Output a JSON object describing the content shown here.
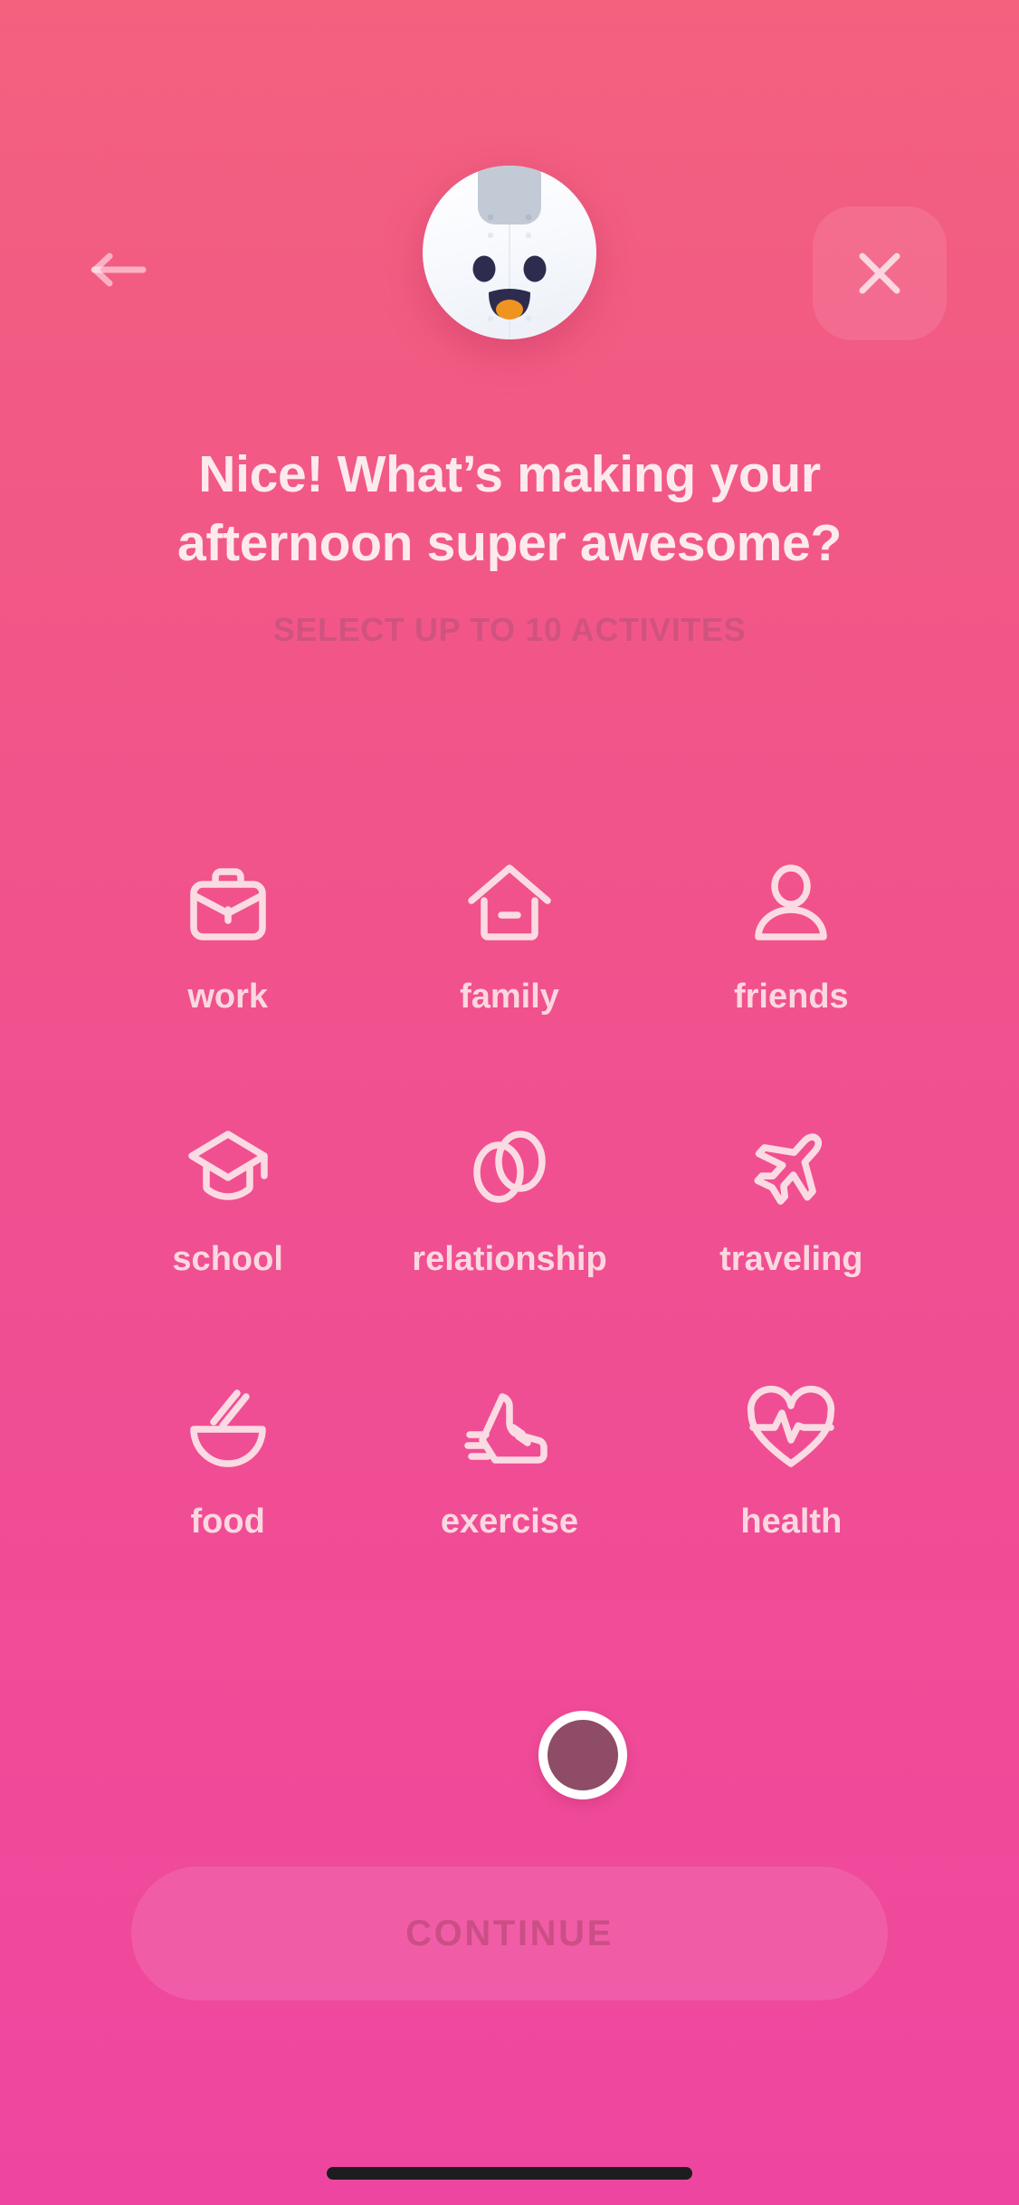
{
  "screen": {
    "name": "activity-select",
    "background_top": "#f3617f",
    "background_bottom": "#ee46a0"
  },
  "header": {
    "back_icon": "arrow-left-icon",
    "close_icon": "close-x-icon",
    "mascot_icon": "mascot-avatar-icon",
    "mascot_description": "white round character face with gray cap, dark eyes and open mouth with orange tongue"
  },
  "headings": {
    "title": "Nice! What’s making your afternoon super awesome?",
    "subtitle": "SELECT UP TO 10 ACTIVITES",
    "title_color": "#fdeaee",
    "subtitle_color": "#d0537f"
  },
  "activities": [
    {
      "label": "work",
      "icon": "briefcase-icon",
      "selected": false
    },
    {
      "label": "family",
      "icon": "house-icon",
      "selected": false
    },
    {
      "label": "friends",
      "icon": "person-icon",
      "selected": false
    },
    {
      "label": "school",
      "icon": "graduation-cap-icon",
      "selected": false
    },
    {
      "label": "relationship",
      "icon": "linked-rings-icon",
      "selected": false
    },
    {
      "label": "traveling",
      "icon": "airplane-icon",
      "selected": false
    },
    {
      "label": "food",
      "icon": "bowl-chopsticks-icon",
      "selected": false
    },
    {
      "label": "exercise",
      "icon": "running-shoe-icon",
      "selected": false
    },
    {
      "label": "health",
      "icon": "heart-pulse-icon",
      "selected": false
    }
  ],
  "spinner": {
    "name": "loading-dot",
    "fill_color": "#8e4c66",
    "ring_color": "#ffffff"
  },
  "footer": {
    "continue_label": "CONTINUE",
    "continue_enabled": false,
    "continue_text_color": "#cb4e86"
  },
  "system": {
    "home_indicator_color": "#1d1d20"
  }
}
